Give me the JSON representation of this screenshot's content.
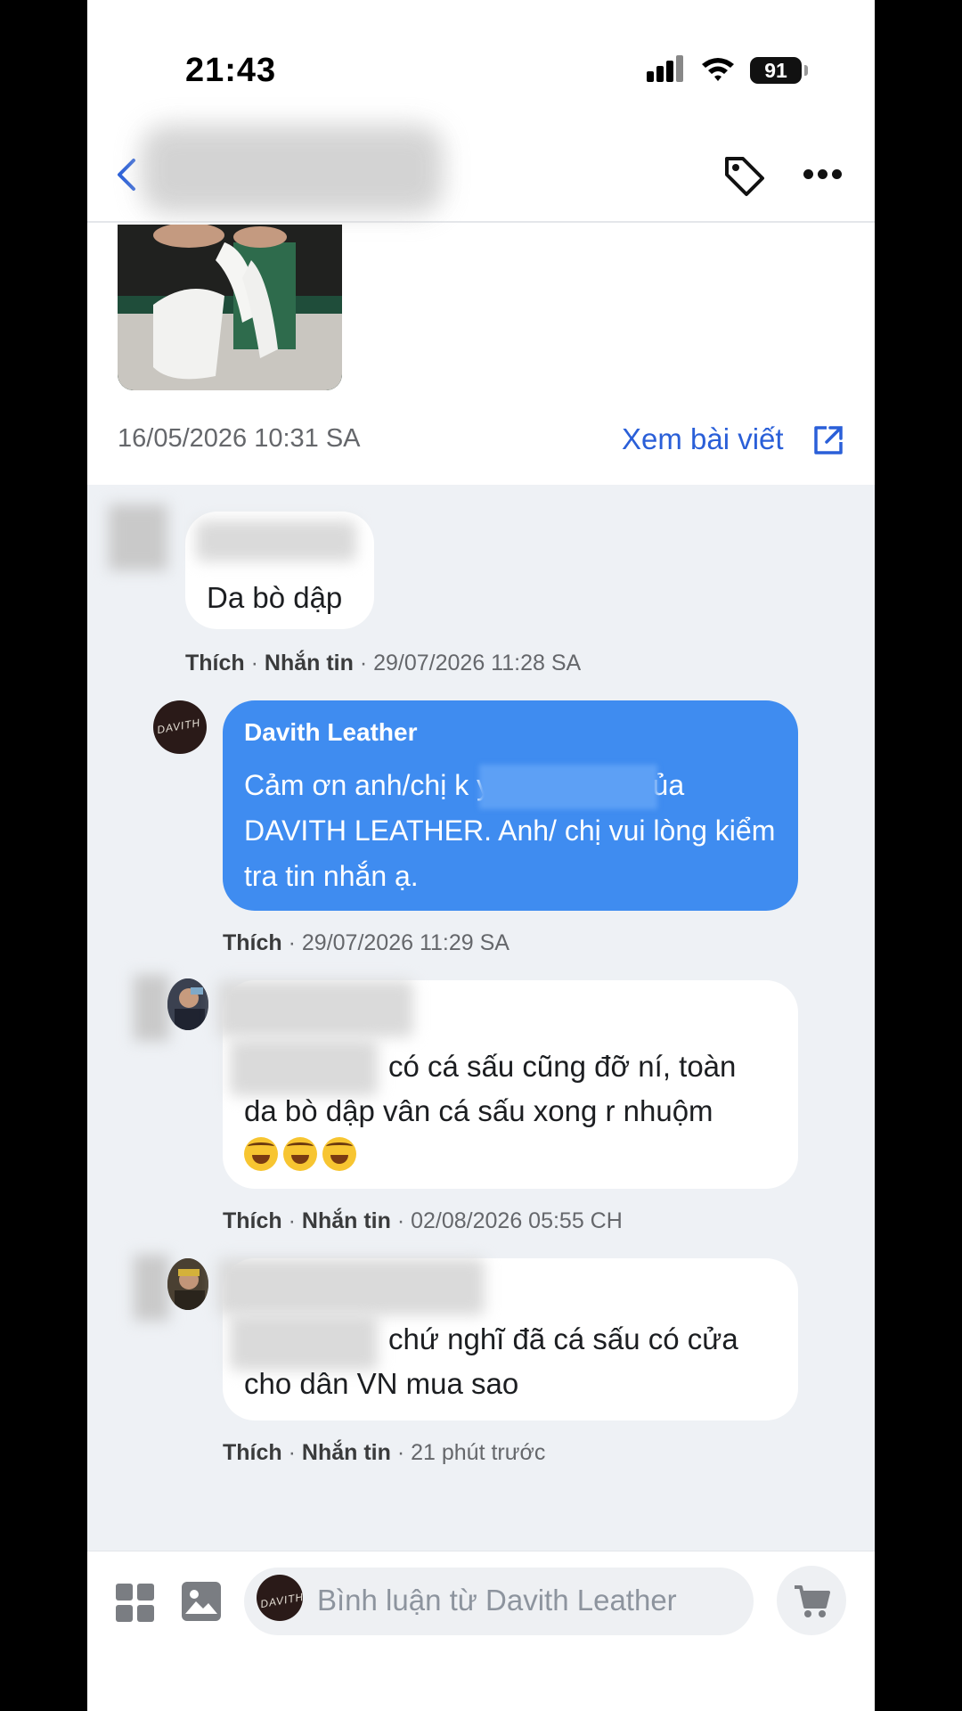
{
  "status_bar": {
    "time": "21:43",
    "battery": "91"
  },
  "header": {
    "blurred_title": ""
  },
  "post": {
    "date": "16/05/2026 10:31 SA",
    "view_post_label": "Xem bài viết"
  },
  "comments": [
    {
      "text": "Da bò dập",
      "like": "Thích",
      "message": "Nhắn tin",
      "time": "29/07/2026 11:28 SA"
    },
    {
      "reply": {
        "author": "Davith Leather",
        "text": "Cảm ơn anh/chị k                    yêu thích sp của DAVITH LEATHER. Anh/ chị vui lòng kiểm tra tin nhắn ạ.",
        "like": "Thích",
        "time": "29/07/2026 11:29 SA"
      }
    },
    {
      "line1": "có cá sấu cũng đỡ ní, toàn",
      "line2": "da bò dập vân cá sấu xong r nhuộm",
      "emoji": "🤣🤣🤣",
      "like": "Thích",
      "message": "Nhắn tin",
      "time": "02/08/2026 05:55 CH"
    },
    {
      "line1": "chứ nghĩ đã cá sấu có cửa",
      "line2": "cho dân VN mua sao",
      "like": "Thích",
      "message": "Nhắn tin",
      "time": "21 phút trước"
    }
  ],
  "page_avatar_text": "DAVITH",
  "composer": {
    "placeholder": "Bình luận từ Davith Leather"
  },
  "icons": [
    "back-icon",
    "tag-icon",
    "more-icon",
    "external-link-icon",
    "grid-icon",
    "image-icon",
    "cart-icon"
  ],
  "colors": {
    "accent": "#2a5fd8",
    "reply_bubble": "#3f8cf0",
    "thread_bg": "#eef1f5"
  }
}
